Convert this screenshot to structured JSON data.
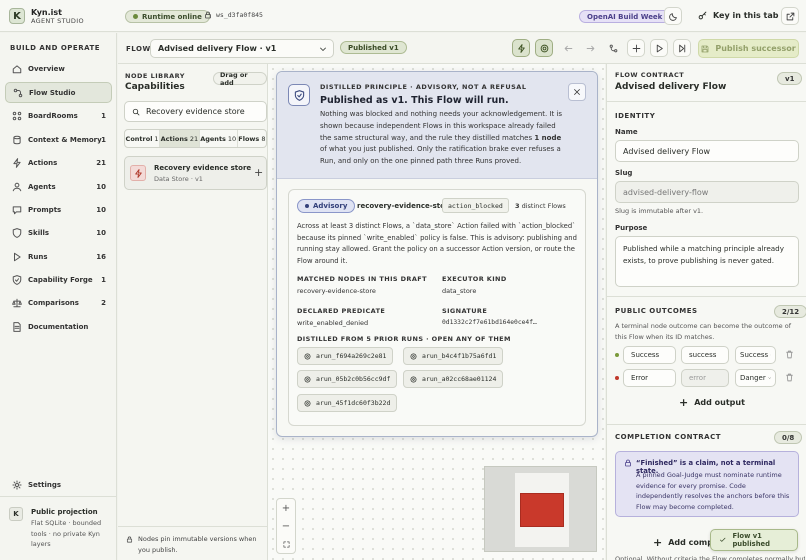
{
  "app": {
    "logo_letter": "K",
    "name": "Kyn.ist",
    "subtitle": "AGENT STUDIO"
  },
  "topbar": {
    "runtime_status": "Runtime online",
    "workspace": "ws_d3fa0f845",
    "build_week_badge": "OpenAI Build Week",
    "key_label": "Key in this tab"
  },
  "sidebar": {
    "section_title": "BUILD AND OPERATE",
    "items": [
      {
        "label": "Overview",
        "count": "",
        "icon": "home-icon"
      },
      {
        "label": "Flow Studio",
        "count": "",
        "icon": "flow-icon"
      },
      {
        "label": "BoardRooms",
        "count": "1",
        "icon": "boardroom-icon"
      },
      {
        "label": "Context & Memory",
        "count": "1",
        "icon": "database-icon"
      },
      {
        "label": "Actions",
        "count": "21",
        "icon": "bolt-icon"
      },
      {
        "label": "Agents",
        "count": "10",
        "icon": "agent-icon"
      },
      {
        "label": "Prompts",
        "count": "10",
        "icon": "prompt-icon"
      },
      {
        "label": "Skills",
        "count": "10",
        "icon": "skill-icon"
      },
      {
        "label": "Runs",
        "count": "16",
        "icon": "runs-icon"
      },
      {
        "label": "Capability Forge",
        "count": "1",
        "icon": "forge-icon"
      },
      {
        "label": "Comparisons",
        "count": "2",
        "icon": "compare-icon"
      },
      {
        "label": "Documentation",
        "count": "",
        "icon": "docs-icon"
      }
    ],
    "settings": "Settings",
    "projection": {
      "avatar": "K",
      "title": "Public projection",
      "desc": "Flat SQLite · bounded tools · no private Kyn layers"
    }
  },
  "flowbar": {
    "label": "FLOW",
    "selected_flow": "Advised delivery Flow · v1",
    "status_badge": "Published v1",
    "publish_button": "Publish successor"
  },
  "library": {
    "section": "NODE LIBRARY",
    "title": "Capabilities",
    "drag_hint": "Drag or add",
    "search_value": "Recovery evidence store",
    "tabs": [
      {
        "label": "Control",
        "count": "1"
      },
      {
        "label": "Actions",
        "count": "21"
      },
      {
        "label": "Agents",
        "count": "10"
      },
      {
        "label": "Flows",
        "count": "8"
      }
    ],
    "result": {
      "name": "Recovery evidence store",
      "meta": "Data Store · v1"
    },
    "footer": "Nodes pin immutable versions when you publish."
  },
  "modal": {
    "eyebrow": "DISTILLED PRINCIPLE · ADVISORY, NOT A REFUSAL",
    "title": "Published as v1. This Flow will run.",
    "body": "Nothing was blocked and nothing needs your acknowledgement. It is shown because independent Flows in this workspace already failed the same structural way, and the rule they distilled matches",
    "body_bold": "1 node",
    "body_end": "of what you just published. Only the ratification brake ever refuses a Run, and only on the one pinned path three Runs proved.",
    "card": {
      "badge": "Advisory",
      "node": "recovery-evidence-store",
      "code": "action_blocked",
      "distinct_count": "3",
      "distinct_label": "distinct Flows",
      "description": "Across at least 3 distinct Flows, a `data_store` Action failed with `action_blocked` because its pinned `write_enabled` policy is false. This is advisory: publishing and running stay allowed. Grant the policy on a successor Action version, or route the Flow around it.",
      "matched_label": "MATCHED NODES IN THIS DRAFT",
      "matched_value": "recovery-evidence-store",
      "executor_label": "EXECUTOR KIND",
      "executor_value": "data_store",
      "predicate_label": "DECLARED PREDICATE",
      "predicate_value": "write_enabled_denied",
      "signature_label": "SIGNATURE",
      "signature_value": "0d1332c2f7e61bd164e0ce4f…",
      "distilled_label": "DISTILLED FROM 5 PRIOR RUNS · OPEN ANY OF THEM",
      "runs": [
        "arun_f694a269c2e81",
        "arun_b4c4f1b75a6fd1",
        "arun_05b2c0b56cc9df",
        "arun_a02cc68ae01124",
        "arun_45f1dc60f3b22d"
      ]
    }
  },
  "contract": {
    "section": "FLOW CONTRACT",
    "title": "Advised delivery Flow",
    "version": "v1",
    "identity": "IDENTITY",
    "name_label": "Name",
    "name_value": "Advised delivery Flow",
    "slug_label": "Slug",
    "slug_value": "advised-delivery-flow",
    "slug_note": "Slug is immutable after v1.",
    "purpose_label": "Purpose",
    "purpose_value": "Published while a matching principle already exists, to prove publishing is never gated.",
    "outcomes_title": "PUBLIC OUTCOMES",
    "outcomes_count": "2/12",
    "outcomes_note": "A terminal node outcome can become the outcome of this Flow when its ID matches.",
    "outcomes": [
      {
        "label": "Success",
        "id": "success",
        "tone": "Success",
        "color": "#7a9a3a"
      },
      {
        "label": "Error",
        "id": "error",
        "tone": "Danger",
        "color": "#c0392b"
      }
    ],
    "add_output": "Add output",
    "completion_title": "COMPLETION CONTRACT",
    "completion_count": "0/8",
    "claim_title": "“Finished” is a claim, not a terminal state.",
    "claim_body": "A pinned Goal-Judge must nominate runtime evidence for every promise. Code independently resolves the anchors before this Flow may become completed.",
    "add_completion": "Add comple",
    "footer_partial": "Optional. Without criteria the Flow completes normally but"
  },
  "toast": "Flow v1 published",
  "colors": {
    "accent_green": "#6b8a3c",
    "modal_head": "#e2e5ef",
    "claim_bg": "#e4e3f3",
    "minimap_node": "#c9392b",
    "build_badge": "#e6e1f6"
  }
}
